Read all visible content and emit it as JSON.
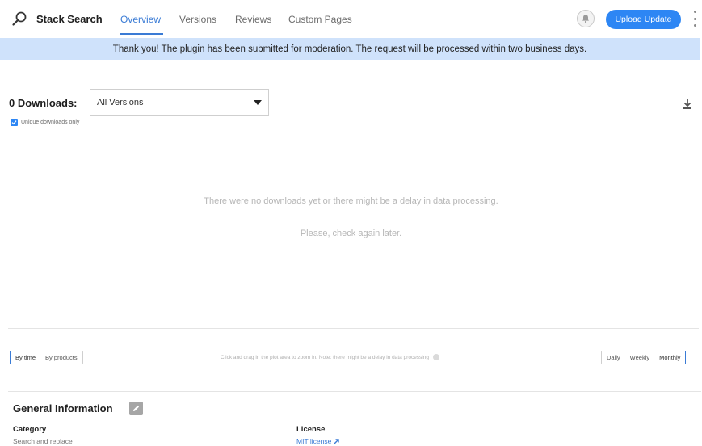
{
  "header": {
    "plugin_title": "Stack Search",
    "tabs": [
      {
        "label": "Overview",
        "active": true
      },
      {
        "label": "Versions",
        "active": false
      },
      {
        "label": "Reviews",
        "active": false
      },
      {
        "label": "Custom Pages",
        "active": false
      }
    ],
    "upload_label": "Upload Update",
    "icons": {
      "logo": "magnifier-icon",
      "bell": "bell-icon",
      "more": "kebab-menu-icon"
    }
  },
  "banner": {
    "message": "Thank you! The plugin has been submitted for moderation. The request will be processed within two business days."
  },
  "downloads": {
    "title": "0 Downloads:",
    "version_select": "All Versions",
    "unique_label": "Unique downloads only",
    "unique_checked": true,
    "empty_line1": "There were no downloads yet or there might be a delay in data processing.",
    "empty_line2": "Please, check again later."
  },
  "chart_controls": {
    "group_by": [
      {
        "label": "By time",
        "active": true
      },
      {
        "label": "By products",
        "active": false
      }
    ],
    "hint": "Click and drag in the plot area to zoom in. Note: there might be a delay in data processing",
    "period": [
      {
        "label": "Daily",
        "active": false
      },
      {
        "label": "Weekly",
        "active": false
      },
      {
        "label": "Monthly",
        "active": true
      }
    ]
  },
  "general_info": {
    "title": "General Information",
    "category_label": "Category",
    "category_value": "Search and replace",
    "license_label": "License",
    "license_value": "MIT license"
  },
  "colors": {
    "accent": "#2d86f4",
    "banner_bg": "#cfe2fb",
    "link": "#3a7bd5"
  }
}
